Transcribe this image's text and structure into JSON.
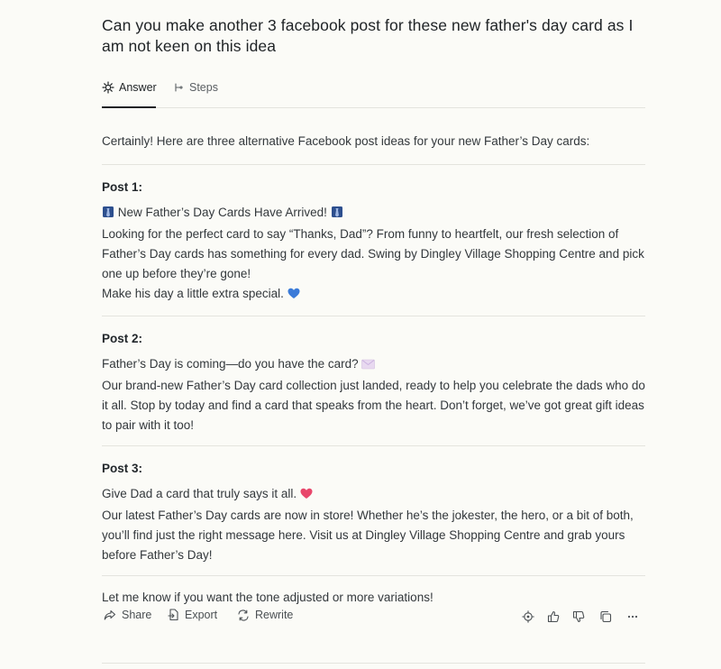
{
  "question": "Can you make another 3 facebook post for these new father's day card as I am not keen on this idea",
  "tabs": [
    {
      "label": "Answer",
      "icon": "sparkle-icon"
    },
    {
      "label": "Steps",
      "icon": "steps-icon"
    }
  ],
  "answer": {
    "intro": "Certainly! Here are three alternative Facebook post ideas for your new Father’s Day cards:",
    "posts": [
      {
        "title": "Post 1:",
        "lines": [
          "New Father’s Day Cards Have Arrived!",
          "Looking for the perfect card to say “Thanks, Dad”? From funny to heartfelt, our fresh selection of Father’s Day cards has something for every dad. Swing by Dingley Village Shopping Centre and pick one up before they’re gone!",
          "Make his day a little extra special."
        ]
      },
      {
        "title": "Post 2:",
        "lines": [
          "Father’s Day is coming—do you have the card?",
          "Our brand-new Father’s Day card collection just landed, ready to help you celebrate the dads who do it all. Stop by today and find a card that speaks from the heart. Don’t forget, we’ve got great gift ideas to pair with it too!"
        ]
      },
      {
        "title": "Post 3:",
        "lines": [
          "Give Dad a card that truly says it all.",
          "Our latest Father’s Day cards are now in store! Whether he’s the jokester, the hero, or a bit of both, you’ll find just the right message here. Visit us at Dingley Village Shopping Centre and grab yours before Father’s Day!"
        ]
      }
    ],
    "closing": "Let me know if you want the tone adjusted or more variations!"
  },
  "actions": {
    "share": "Share",
    "export": "Export",
    "rewrite": "Rewrite"
  },
  "colors": {
    "background": "#fbfbf7",
    "text": "#33383c",
    "divider": "#e4e4de",
    "tie_emoji": "#2d4f8e",
    "blue_heart": "#3b7bd8",
    "pink_heart": "#e8476b",
    "envelope": "#e8d9f0"
  }
}
